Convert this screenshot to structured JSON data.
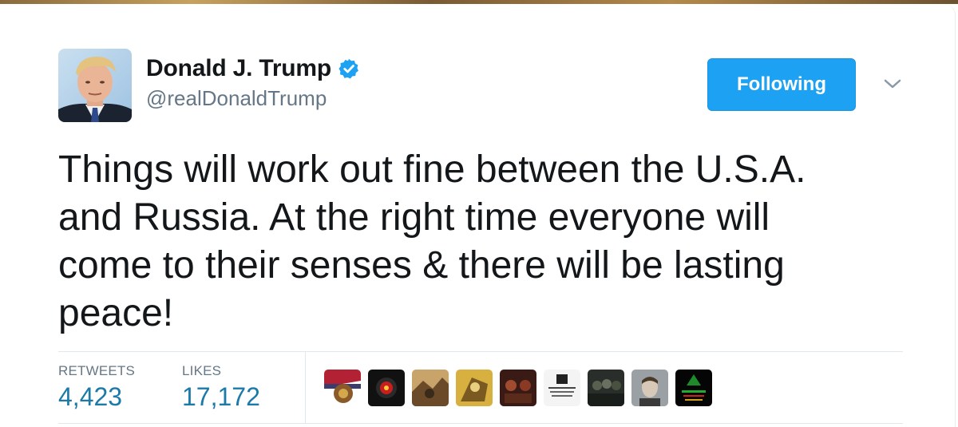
{
  "tweet": {
    "author": {
      "name": "Donald J. Trump",
      "handle": "@realDonaldTrump",
      "verified": true
    },
    "follow_button_label": "Following",
    "text": "Things will work out fine between the U.S.A.\nand Russia. At the right time everyone will\ncome to their senses & there will be lasting\npeace!",
    "stats": {
      "retweets_label": "RETWEETS",
      "retweets_value": "4,423",
      "likes_label": "LIKES",
      "likes_value": "17,172"
    },
    "likers_count_shown": 9
  },
  "colors": {
    "follow_button": "#1da1f2",
    "stat_value": "#1b7aa8",
    "secondary_text": "#657786",
    "primary_text": "#14171a",
    "verified_badge": "#1da1f2"
  },
  "icons": [
    "verified-badge-icon",
    "chevron-down-icon"
  ]
}
